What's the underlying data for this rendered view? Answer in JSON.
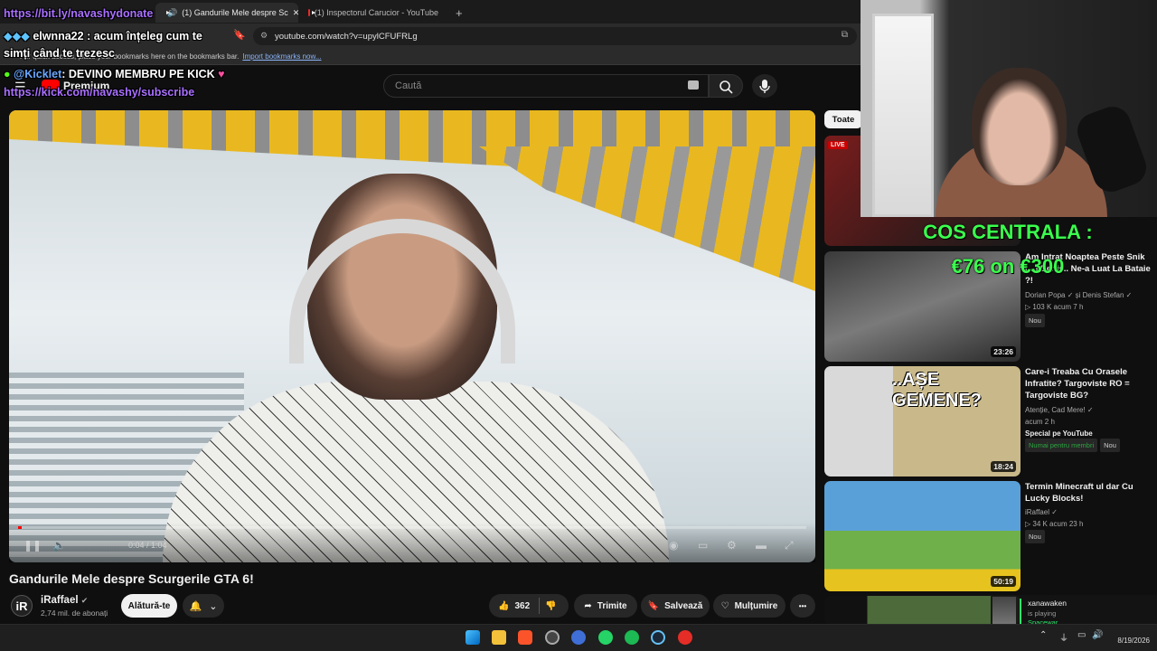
{
  "browser": {
    "tabs": [
      {
        "label": "(1) Gandurile Mele despre Sc",
        "active": true
      },
      {
        "label": "(1) Inspectorul Carucior - YouTube",
        "active": false
      }
    ],
    "new_tab": "+",
    "url": "youtube.com/watch?v=upylCFUFRLg",
    "bookmarks_hint": "For quick access, place your bookmarks here on the bookmarks bar.",
    "bookmarks_link": "Import bookmarks now..."
  },
  "header": {
    "logo": "Premium",
    "search_placeholder": "Caută"
  },
  "chat_overlay": {
    "line1": "https://bit.ly/navashydonate",
    "line2_user": "elwnna22",
    "line2_text": ": acum înțeleg cum te",
    "line3": "simți când te trezesc",
    "line4_user": "@Kicklet",
    "line4_text": ": DEVINO MEMBRU PE KICK",
    "line5": "https://kick.com/navashy/subscribe"
  },
  "video": {
    "title": "Gandurile Mele despre Scurgerile GTA 6!",
    "time": "0:04 / 1:04",
    "progress": 0.005
  },
  "channel": {
    "avatar": "iR",
    "name": "iRaffael",
    "subs": "2,74 mil. de abonați",
    "join": "Alătură-te"
  },
  "actions": {
    "likes": "362",
    "share": "Trimite",
    "save": "Salvează",
    "thanks": "Mulțumire",
    "more": "•••"
  },
  "sidebar": {
    "chip": "Toate",
    "live": "LIVE",
    "items": [
      {
        "title": "Am Intrat Noaptea Peste Snik (...) Denis.. Ne-a Luat La Bataie ?!",
        "channel": "Dorian Popa ✓ și Denis Stefan ✓",
        "meta": "▷ 103 K   acum 7 h",
        "badge": "Nou",
        "duration": "23:26"
      },
      {
        "title": "Care-i Treaba Cu Orasele Infratite? Targoviste RO = Targoviste BG?",
        "channel": "Atenție, Cad Mere! ✓",
        "meta": "acum 2 h",
        "special": "Special pe YouTube",
        "members": "Numai pentru membri",
        "badge": "Nou",
        "duration": "18:24",
        "thumb_text": "..AȘE GEMENE?"
      },
      {
        "title": "Termin Minecraft ul dar Cu Lucky Blocks!",
        "channel": "iRaffael ✓",
        "meta": "▷ 34 K   acum 23 h",
        "badge": "Nou",
        "duration": "50:19"
      }
    ]
  },
  "stream_overlay": {
    "goal_title": "COS CENTRALA :",
    "goal_amount": "€76 on €300",
    "now_playing_user": "xanawaken",
    "now_playing_status": "is playing",
    "now_playing_game": "Spacewar"
  },
  "taskbar": {
    "date": "8/19/2026"
  },
  "colors": {
    "accent": "#ff0000",
    "goal_green": "#3aff4d",
    "chat_link": "#a970ff"
  }
}
